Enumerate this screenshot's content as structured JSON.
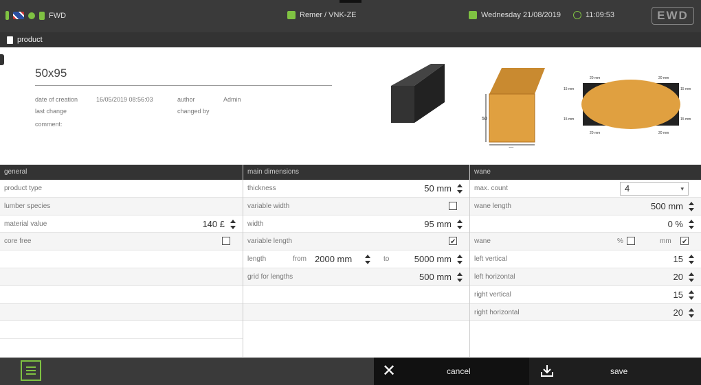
{
  "topbar": {
    "user": "FWD",
    "station": "Remer / VNK-ZE",
    "date": "Wednesday  21/08/2019",
    "time": "11:09:53",
    "logo": "EWD"
  },
  "subbar": {
    "title": "product"
  },
  "product": {
    "name": "50x95",
    "date_label": "date of creation",
    "date_value": "16/05/2019 08:56:03",
    "author_label": "author",
    "author_value": "Admin",
    "last_change_label": "last change",
    "changed_by_label": "changed by",
    "comment_label": "comment:"
  },
  "diagram": {
    "timber_height_label": "50",
    "timber_width_label": "95",
    "wane_top_left": "20 mm",
    "wane_top_right": "20 mm",
    "wane_right_top": "15 mm",
    "wane_right_bottom": "15 mm",
    "wane_bottom_left": "20 mm",
    "wane_bottom_right": "20 mm",
    "wane_left_top": "15 mm",
    "wane_left_bottom": "15 mm"
  },
  "general": {
    "header": "general",
    "product_type": "product type",
    "lumber_species": "lumber species",
    "material_value": "material value",
    "material_value_amount": "140 £",
    "core_free": "core free"
  },
  "main": {
    "header": "main dimensions",
    "thickness": "thickness",
    "thickness_value": "50 mm",
    "variable_width": "variable width",
    "width": "width",
    "width_value": "95 mm",
    "variable_length": "variable length",
    "length": "length",
    "from": "from",
    "length_from": "2000 mm",
    "to": "to",
    "length_to": "5000 mm",
    "grid_for_lengths": "grid for lengths",
    "grid_value": "500 mm"
  },
  "wane": {
    "header": "wane",
    "max_count": "max. count",
    "max_count_value": "4",
    "wane_length": "wane length",
    "wane_length_value": "500 mm",
    "percent_value": "0 %",
    "wane": "wane",
    "pct": "%",
    "mm": "mm",
    "left_vertical": "left vertical",
    "left_vertical_value": "15",
    "left_horizontal": "left horizontal",
    "left_horizontal_value": "20",
    "right_vertical": "right vertical",
    "right_vertical_value": "15",
    "right_horizontal": "right horizontal",
    "right_horizontal_value": "20"
  },
  "footer": {
    "cancel": "cancel",
    "save": "save"
  },
  "icons": {
    "menu": "menu-icon",
    "cancel": "close-icon",
    "save": "download-icon",
    "calendar": "calendar-icon",
    "clock": "clock-icon",
    "flag": "uk-flag-icon"
  },
  "colors": {
    "accent": "#7fc242",
    "timber": "#e0a040",
    "dark": "#3a3a3a"
  }
}
